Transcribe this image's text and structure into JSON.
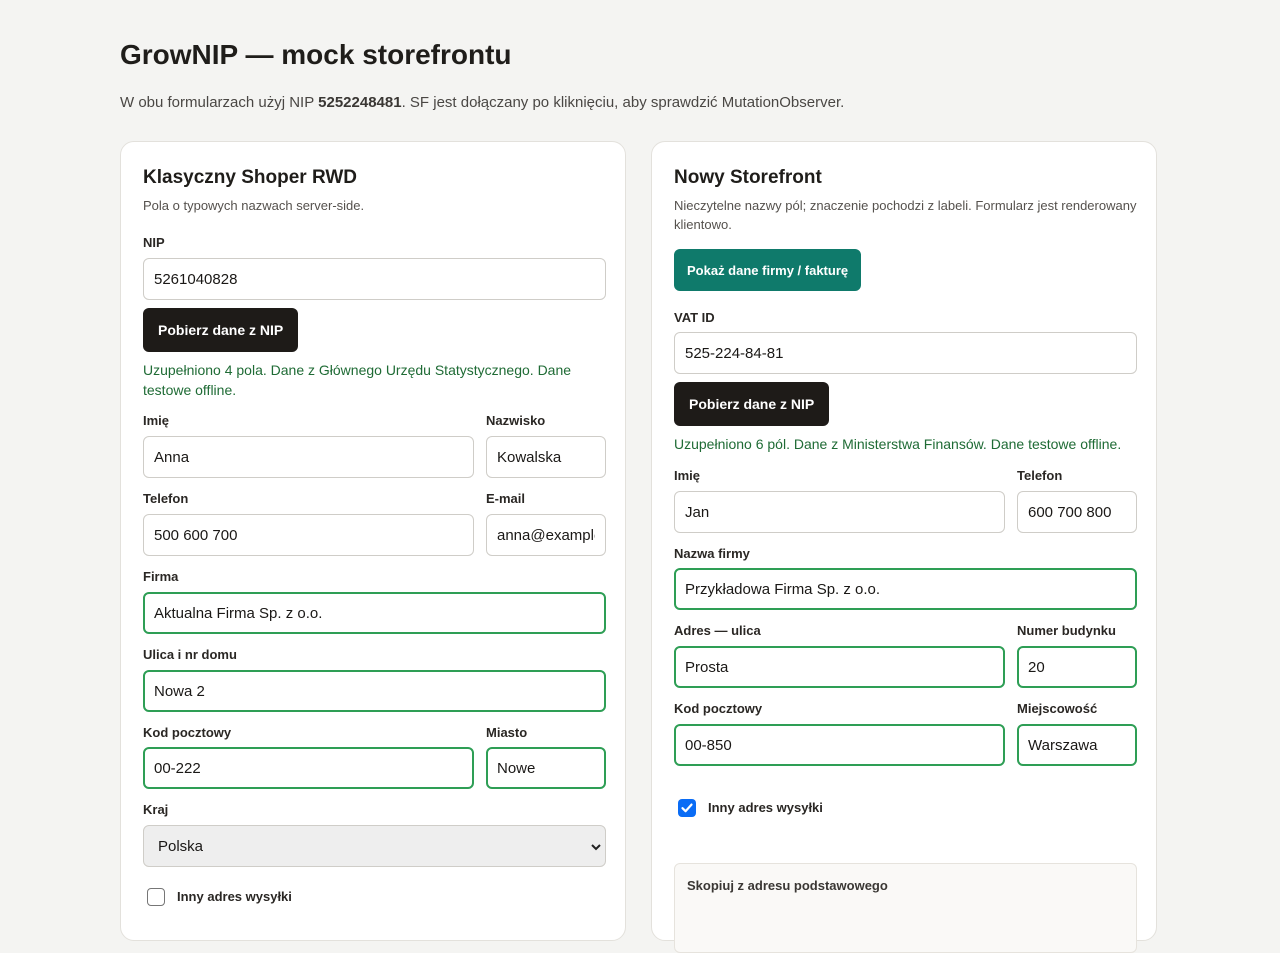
{
  "page": {
    "title": "GrowNIP — mock storefrontu",
    "intro_prefix": "W obu formularzach użyj NIP ",
    "intro_nip": "5252248481",
    "intro_suffix": ". SF jest dołączany po kliknięciu, aby sprawdzić MutationObserver."
  },
  "classic": {
    "title": "Klasyczny Shoper RWD",
    "description": "Pola o typowych nazwach server-side.",
    "nip_label": "NIP",
    "nip_value": "5261040828",
    "fetch_button": "Pobierz dane z NIP",
    "status_line1": "Uzupełniono 4 pola. Dane z Głównego Urzędu Statystycznego. Dane",
    "status_line2": "testowe offline.",
    "first_name_label": "Imię",
    "first_name_value": "Anna",
    "last_name_label": "Nazwisko",
    "last_name_value": "Kowalska",
    "phone_label": "Telefon",
    "phone_value": "500 600 700",
    "email_label": "E-mail",
    "email_value": "anna@example",
    "company_label": "Firma",
    "company_value": "Aktualna Firma Sp. z o.o.",
    "street_label": "Ulica i nr domu",
    "street_value": "Nowa 2",
    "postcode_label": "Kod pocztowy",
    "postcode_value": "00-222",
    "city_label": "Miasto",
    "city_value": "Nowe",
    "country_label": "Kraj",
    "country_value": "Polska",
    "other_shipping_label": "Inny adres wysyłki",
    "other_shipping_checked": false
  },
  "storefront": {
    "title": "Nowy Storefront",
    "description_line1": "Nieczytelne nazwy pól; znaczenie pochodzi z labeli. Formularz jest renderowany",
    "description_line2": "klientowo.",
    "show_company_button": "Pokaż dane firmy / fakturę",
    "vat_label": "VAT ID",
    "vat_value": "525-224-84-81",
    "fetch_button": "Pobierz dane z NIP",
    "status": "Uzupełniono 6 pól. Dane z Ministerstwa Finansów. Dane testowe offline.",
    "first_name_label": "Imię",
    "first_name_value": "Jan",
    "phone_label": "Telefon",
    "phone_value": "600 700 800",
    "company_label": "Nazwa firmy",
    "company_value": "Przykładowa Firma Sp. z o.o.",
    "street_label": "Adres — ulica",
    "street_value": "Prosta",
    "building_label": "Numer budynku",
    "building_value": "20",
    "postcode_label": "Kod pocztowy",
    "postcode_value": "00-850",
    "city_label": "Miejscowość",
    "city_value": "Warszawa",
    "other_shipping_label": "Inny adres wysyłki",
    "other_shipping_checked": true,
    "copy_box_title": "Skopiuj z adresu podstawowego"
  },
  "icons": {
    "select_chevron": "chevron-down-icon",
    "checkbox_check": "check-icon"
  },
  "colors": {
    "background": "#f4f4f2",
    "success_border": "#2e9e55",
    "success_text": "#1f6b35",
    "dark_button": "#1e1b18",
    "teal_button": "#0f7a6b",
    "checkbox_checked": "#0a6cf5"
  }
}
